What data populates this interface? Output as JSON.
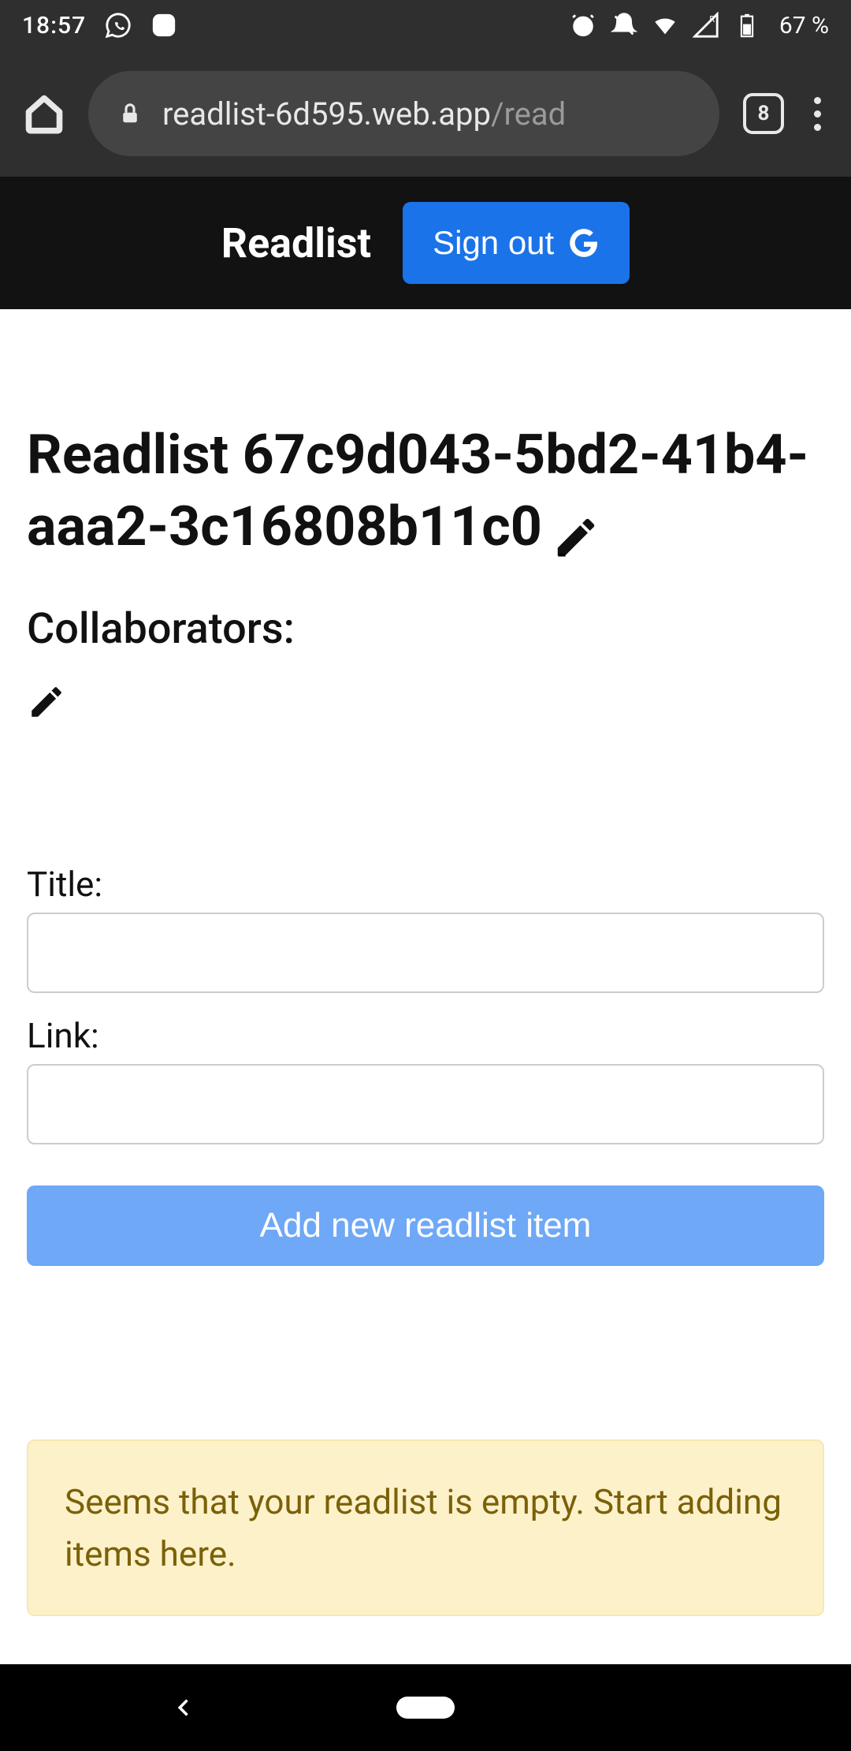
{
  "status": {
    "time": "18:57",
    "battery_pct": "67 %"
  },
  "browser": {
    "url_host": "readlist-6d595.web.app",
    "url_path": "/read",
    "tab_count": "8"
  },
  "header": {
    "brand": "Readlist",
    "signout_label": "Sign out"
  },
  "main": {
    "title": "Readlist 67c9d043-5bd2-41b4-aaa2-3c16808b11c0",
    "collaborators_label": "Collaborators:",
    "form": {
      "title_label": "Title:",
      "link_label": "Link:",
      "title_value": "",
      "link_value": "",
      "add_button": "Add new readlist item"
    },
    "empty_alert": "Seems that your readlist is empty. Start adding items here."
  }
}
